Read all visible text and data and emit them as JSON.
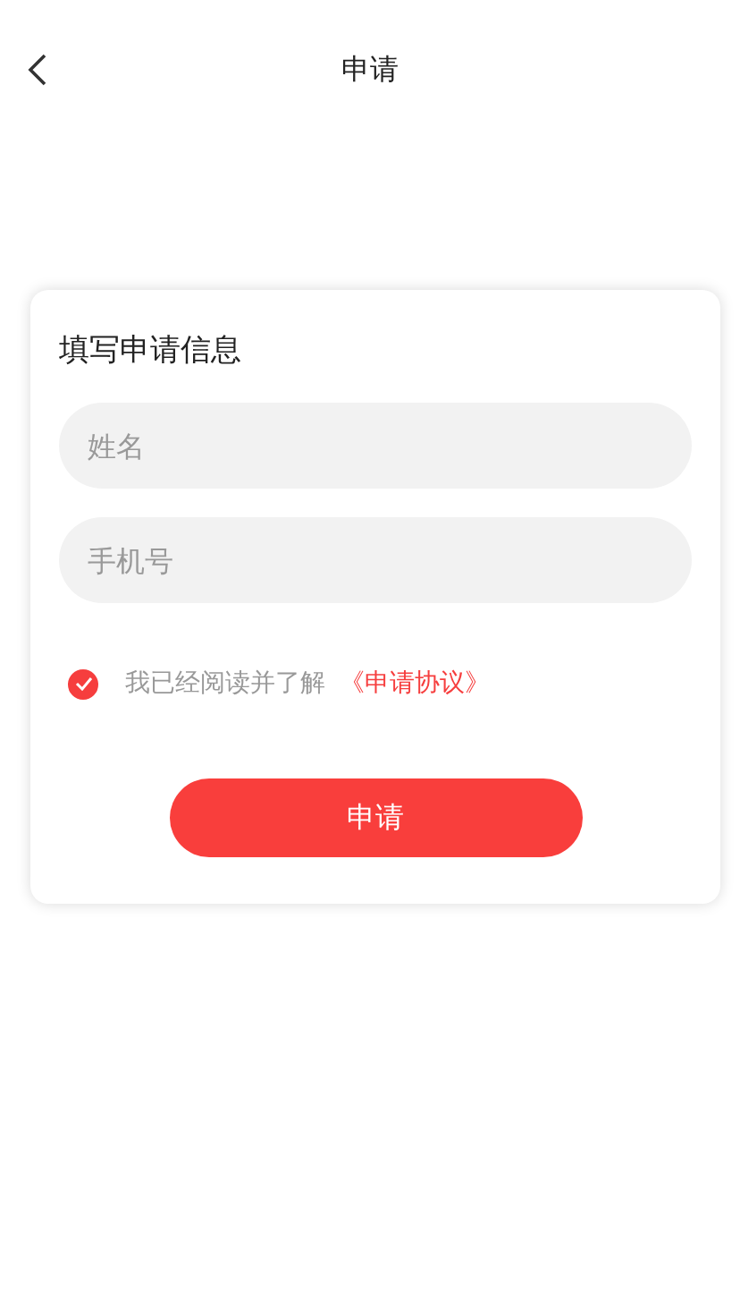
{
  "header": {
    "title": "申请"
  },
  "form": {
    "heading": "填写申请信息",
    "fields": [
      {
        "placeholder": "姓名"
      },
      {
        "placeholder": "手机号"
      }
    ],
    "agreement": {
      "checked": true,
      "text": "我已经阅读并了解",
      "link": "《申请协议》"
    },
    "submit": "申请"
  }
}
